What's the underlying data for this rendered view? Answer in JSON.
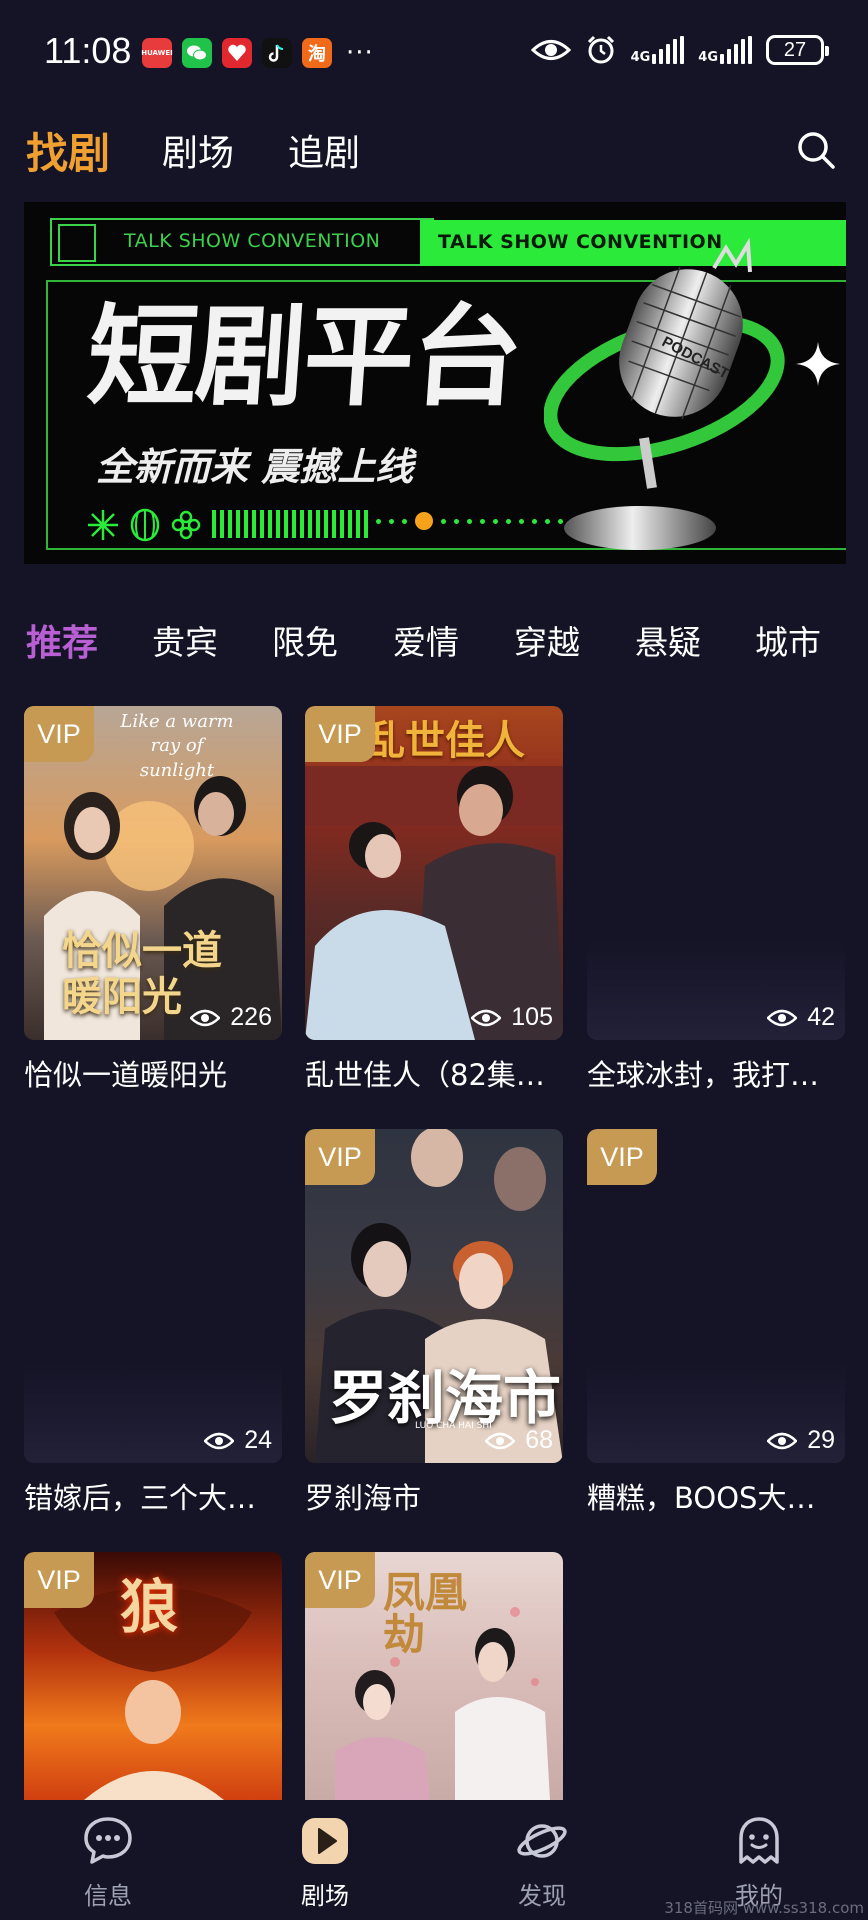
{
  "status_bar": {
    "time": "11:08",
    "apps": [
      {
        "icon": "huawei-store-icon",
        "label": "HUAWEI",
        "color": "#e83b3b"
      },
      {
        "icon": "wechat-icon",
        "label": "",
        "color": "#21c24a"
      },
      {
        "icon": "gift-app-icon",
        "label": "",
        "color": "#e0282e"
      },
      {
        "icon": "tiktok-icon",
        "label": "",
        "color": "#111111"
      },
      {
        "icon": "taobao-icon",
        "label": "淘",
        "color": "#f06a1a"
      }
    ],
    "more": "···",
    "network_1": "4G",
    "network_2": "4G",
    "battery": "27"
  },
  "top_nav": {
    "tabs": [
      {
        "label": "找剧",
        "active": true
      },
      {
        "label": "剧场",
        "active": false
      },
      {
        "label": "追剧",
        "active": false
      }
    ]
  },
  "banner": {
    "tag_1": "TALK SHOW CONVENTION",
    "tag_2": "TALK SHOW CONVENTION",
    "title": "短剧平台",
    "subtitle": "全新而来 震撼上线",
    "mic_label": "PODCAST",
    "dots_count": 14,
    "active_dot": 3
  },
  "categories": [
    {
      "label": "推荐",
      "active": true
    },
    {
      "label": "贵宾",
      "active": false
    },
    {
      "label": "限免",
      "active": false
    },
    {
      "label": "爱情",
      "active": false
    },
    {
      "label": "穿越",
      "active": false
    },
    {
      "label": "悬疑",
      "active": false
    },
    {
      "label": "城市",
      "active": false
    }
  ],
  "dramas": [
    {
      "title": "恰似一道暖阳光",
      "views": "226",
      "vip": true,
      "overlay": "恰似一道暖阳光",
      "overlay_en": "Like a warm ray of sunlight"
    },
    {
      "title": "乱世佳人（82集…",
      "views": "105",
      "vip": true,
      "overlay": "乱世佳人"
    },
    {
      "title": "全球冰封，我打…",
      "views": "42",
      "vip": false
    },
    {
      "title": "错嫁后，三个大…",
      "views": "24",
      "vip": false
    },
    {
      "title": "罗刹海市",
      "views": "68",
      "vip": true,
      "overlay": "罗刹海市",
      "overlay_en": "LUO CHA HAI SHI"
    },
    {
      "title": "糟糕，BOOS大…",
      "views": "29",
      "vip": true
    },
    {
      "title": "",
      "views": "",
      "vip": true,
      "overlay": "狼"
    },
    {
      "title": "",
      "views": "",
      "vip": true,
      "overlay": "凤凰劫"
    }
  ],
  "vip_label": "VIP",
  "bottom_nav": [
    {
      "label": "信息",
      "icon": "message-icon",
      "active": false
    },
    {
      "label": "剧场",
      "icon": "play-icon",
      "active": true
    },
    {
      "label": "发现",
      "icon": "planet-icon",
      "active": false
    },
    {
      "label": "我的",
      "icon": "ghost-profile-icon",
      "active": false
    }
  ],
  "watermark": "318首码网 www.ss318.com",
  "colors": {
    "background": "#151326",
    "accent_orange": "#f0a030",
    "accent_purple": "#b95fd4",
    "vip_gold": "#c79a54",
    "banner_green": "#2bea3a"
  }
}
